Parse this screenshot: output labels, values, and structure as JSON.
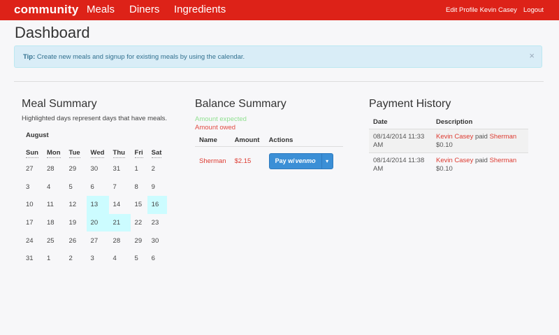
{
  "nav": {
    "brand": "community",
    "links": [
      "Meals",
      "Diners",
      "Ingredients"
    ],
    "edit_profile": "Edit Profile Kevin Casey",
    "logout": "Logout"
  },
  "page_title": "Dashboard",
  "alert": {
    "tip_label": "Tip:",
    "message": "Create new meals and signup for existing meals by using the calendar.",
    "close": "×"
  },
  "meal_summary": {
    "title": "Meal Summary",
    "help": "Highlighted days represent days that have meals.",
    "month": "August",
    "weekdays": [
      "Sun",
      "Mon",
      "Tue",
      "Wed",
      "Thu",
      "Fri",
      "Sat"
    ],
    "weeks": [
      [
        "27",
        "28",
        "29",
        "30",
        "31",
        "1",
        "2"
      ],
      [
        "3",
        "4",
        "5",
        "6",
        "7",
        "8",
        "9"
      ],
      [
        "10",
        "11",
        "12",
        "13",
        "14",
        "15",
        "16"
      ],
      [
        "17",
        "18",
        "19",
        "20",
        "21",
        "22",
        "23"
      ],
      [
        "24",
        "25",
        "26",
        "27",
        "28",
        "29",
        "30"
      ],
      [
        "31",
        "1",
        "2",
        "3",
        "4",
        "5",
        "6"
      ]
    ],
    "highlighted_days": [
      "13",
      "16",
      "20",
      "21"
    ],
    "highlight_color": "#ccfcff"
  },
  "balance_summary": {
    "title": "Balance Summary",
    "legend_expected": "Amount expected",
    "legend_owed": "Amount owed",
    "columns": [
      "Name",
      "Amount",
      "Actions"
    ],
    "rows": [
      {
        "name": "Sherman",
        "amount": "$2.15",
        "action_label": "Pay w/",
        "action_brand": "venmo"
      }
    ],
    "expected_color": "#90e090",
    "owed_color": "#e14b43"
  },
  "payment_history": {
    "title": "Payment History",
    "columns": [
      "Date",
      "Description"
    ],
    "rows": [
      {
        "date": "08/14/2014 11:33 AM",
        "payer": "Kevin Casey",
        "verb": "paid",
        "payee": "Sherman",
        "amount": "$0.10"
      },
      {
        "date": "08/14/2014 11:38 AM",
        "payer": "Kevin Casey",
        "verb": "paid",
        "payee": "Sherman",
        "amount": "$0.10"
      }
    ]
  },
  "colors": {
    "navbar": "#dd2218",
    "alert_bg": "#d9edf7",
    "link": "#dd3a30",
    "venmo_button": "#3b8fd6"
  }
}
